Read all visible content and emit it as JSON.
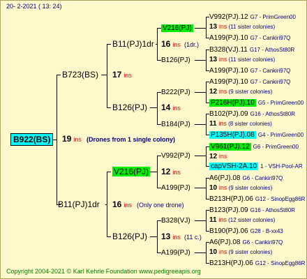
{
  "date": "20-  2-2021  ( 13: 24)",
  "root": {
    "name": "B922(BS)",
    "num": "19",
    "ins": "ins",
    "note": "(Drones from 1 single colony)"
  },
  "g1": [
    {
      "name": "B723(BS)",
      "num": "17",
      "ins": "ins"
    },
    {
      "name": "B11(PJ)1dr",
      "num": "16",
      "ins": "ins",
      "note": "(Only one drone)"
    }
  ],
  "g2": [
    {
      "name": "B11(PJ)1dr"
    },
    {
      "name": "B126(PJ)"
    },
    {
      "name": "V216(PJ)"
    },
    {
      "name": "B126(PJ)"
    }
  ],
  "g2info": [
    {
      "num": "14",
      "ins": "ins"
    },
    {
      "num": "13",
      "ins": "ins",
      "note": "(11 c.)"
    }
  ],
  "g3": [
    {
      "name": "V216(PJ)",
      "num": "16",
      "ins": "ins",
      "note": "(1dr.)"
    },
    {
      "name": "B126(PJ)"
    },
    {
      "name": "B222(PJ)"
    },
    {
      "name": "B184(PJ)"
    },
    {
      "name": "V992(PJ)",
      "num": "12",
      "ins": "ins"
    },
    {
      "name": "A199(PJ)"
    },
    {
      "name": "B328(VJ)",
      "num": "13",
      "ins": "ins",
      "note": "(11 c.)"
    },
    {
      "name": "A199(PJ)"
    }
  ],
  "g4": [
    {
      "name": "V992(PJ).12",
      "drone": "G7 - PrimGreen00"
    },
    {
      "info": "13 ins (11 sister colonies)"
    },
    {
      "name": "A199(PJ).10",
      "drone": "G7 - Cankiri97Q"
    },
    {
      "name": "B328(VJ).11",
      "drone": "G17 - AthosSt80R"
    },
    {
      "info": "13 ins (11 sister colonies)"
    },
    {
      "name": "A199(PJ).10",
      "drone": "G7 - Cankiri97Q"
    },
    {
      "name": "A199(PJ).10",
      "drone": "G7 - Cankiri97Q"
    },
    {
      "info": "12 ins (9 sister colonies)"
    },
    {
      "name": "P216H(PJ).10",
      "drone": "G5 - PrimGreen00"
    },
    {
      "name": "B102(PJ).09",
      "drone": "G16 - AthosSt80R"
    },
    {
      "info": "11 ins (8 sister colonies)"
    },
    {
      "name": "P135H(PJ).08",
      "drone": "G4 - PrimGreen00"
    },
    {
      "name": "V961(PJ).12",
      "drone": "G6 - PrimGreen00"
    },
    {
      "info": "12 ins"
    },
    {
      "name": "capVSH-2A.10",
      "drone": "1 - VSH-Pool-AR"
    },
    {
      "name": "A6(PJ).08",
      "drone": "G6 - Cankiri97Q"
    },
    {
      "info": "10 ins (9 sister colonies)"
    },
    {
      "name": "B213H(PJ).06",
      "drone": "G12 - SinopEgg86R"
    },
    {
      "name": "B123(PJ).09",
      "drone": "G16 - AthosSt80R"
    },
    {
      "info": "11 ins (12 sister colonies)"
    },
    {
      "name": "B190(PJ).06",
      "drone": "G28 - B-xx43"
    },
    {
      "name": "A6(PJ).08",
      "drone": "G6 - Cankiri97Q"
    },
    {
      "info": "10 ins (9 sister colonies)"
    },
    {
      "name": "B213H(PJ).06",
      "drone": "G12 - SinopEgg86R"
    }
  ],
  "footer": "Copyright 2004-2021 © Karl Kehrle Foundation    www.pedigreeapis.org"
}
